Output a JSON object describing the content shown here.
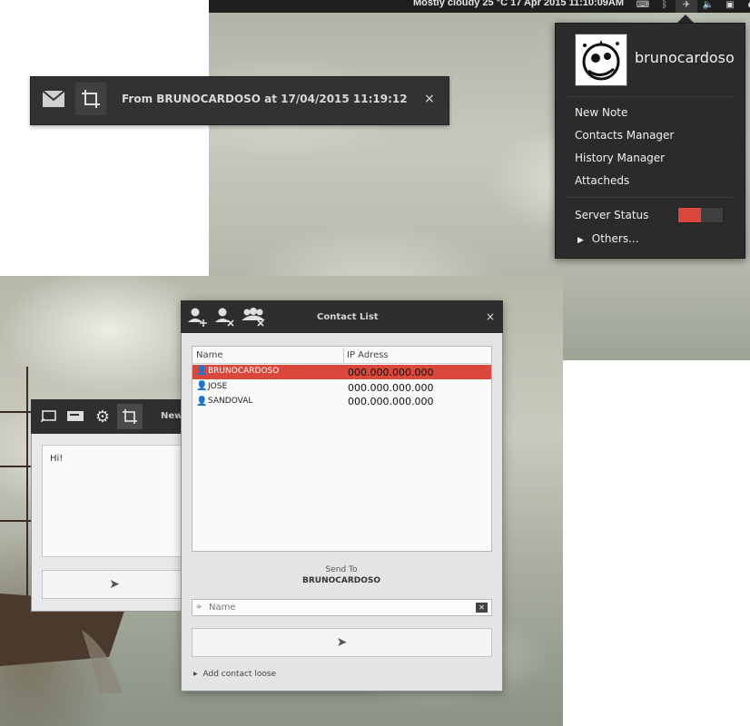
{
  "top_panel": {
    "info_text": "Mostly cloudy 25 °C   17 Apr 2015 11:10:09AM",
    "icons": [
      "keyboard-icon",
      "bluetooth-icon",
      "paper-plane-icon",
      "volume-icon",
      "network-icon",
      "user-icon"
    ]
  },
  "indicator_menu": {
    "username": "brunocardoso",
    "items": [
      "New Note",
      "Contacts Manager",
      "History Manager",
      "Attacheds"
    ],
    "server_status_label": "Server Status",
    "server_status_on": true,
    "others_label": "Others..."
  },
  "notification": {
    "text": "From BRUNOCARDOSO at 17/04/2015 11:19:12",
    "icons": [
      "mail-icon",
      "crop-icon"
    ],
    "close": "×"
  },
  "note_window": {
    "title": "New",
    "tools": [
      "cast-icon",
      "message-icon",
      "gear-icon",
      "crop-icon"
    ],
    "body_text": "Hi!"
  },
  "contact_list": {
    "title": "Contact List",
    "close": "×",
    "tools": [
      "add-contact-icon",
      "remove-contact-icon",
      "remove-group-icon"
    ],
    "columns": [
      "Name",
      "IP Adress"
    ],
    "rows": [
      {
        "name": "BRUNOCARDOSO",
        "ip": "000.000.000.000",
        "selected": true
      },
      {
        "name": "JOSE",
        "ip": "000.000.000.000",
        "selected": false
      },
      {
        "name": "SANDOVAL",
        "ip": "000.000.000.000",
        "selected": false
      }
    ],
    "send_to_label": "Send To",
    "send_to_value": "BRUNOCARDOSO",
    "name_placeholder": "Name",
    "add_loose_label": "Add contact loose"
  },
  "colors": {
    "accent": "#d9483b",
    "dark_bar": "#2e2e2e"
  }
}
